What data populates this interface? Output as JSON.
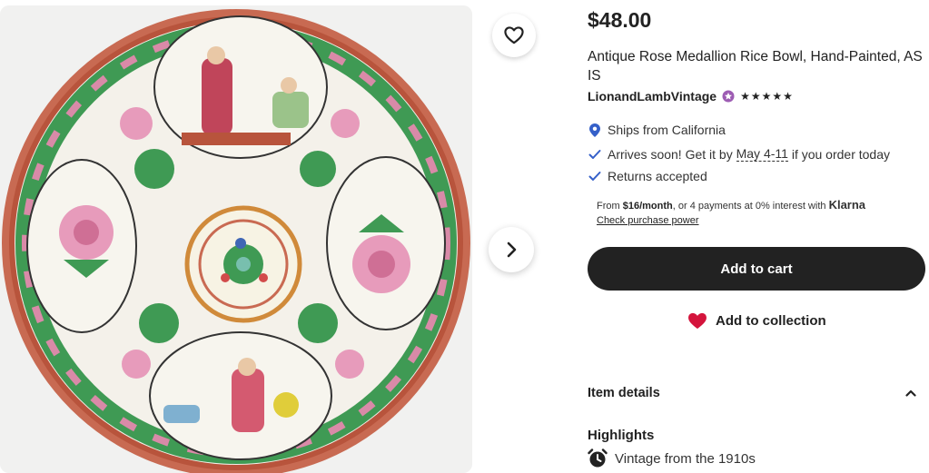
{
  "listing": {
    "price": "$48.00",
    "title": "Antique Rose Medallion Rice Bowl, Hand-Painted, AS IS",
    "shop_name": "LionandLambVintage",
    "rating_stars": "★★★★★",
    "rating": 5
  },
  "gallery": {
    "favorite_icon": "heart-outline-icon",
    "next_icon": "chevron-right-icon"
  },
  "features": {
    "ships": "Ships from California",
    "arrives_prefix": "Arrives soon! Get it by ",
    "arrives_date": "May 4-11",
    "arrives_suffix": " if you order today",
    "returns": "Returns accepted"
  },
  "klarna": {
    "prefix": "From ",
    "amount": "$16/month",
    "middle": ", or 4 payments at 0% interest with ",
    "brand": "Klarna",
    "link": "Check purchase power"
  },
  "actions": {
    "add_to_cart": "Add to cart",
    "add_to_collection": "Add to collection"
  },
  "details": {
    "item_details": "Item details",
    "highlights": "Highlights",
    "vintage": "Vintage from the 1910s"
  },
  "colors": {
    "accent_dark": "#222222",
    "heart_red": "#d4143c",
    "check_blue": "#3560c9",
    "star_badge": "#9d5cb3"
  }
}
